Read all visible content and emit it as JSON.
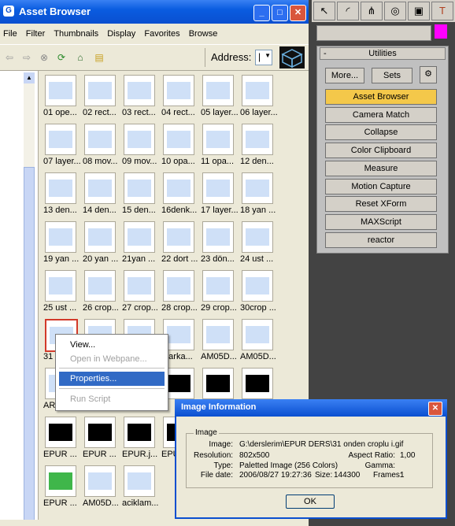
{
  "window": {
    "title": "Asset Browser",
    "minimize": "_",
    "maximize": "□",
    "close": "✕"
  },
  "menu": [
    "File",
    "Filter",
    "Thumbnails",
    "Display",
    "Favorites",
    "Browse"
  ],
  "toolbar": {
    "address_label": "Address:",
    "address_value": "|"
  },
  "thumbnails": [
    [
      "01 ope...",
      "02 rect...",
      "03 rect...",
      "04 rect...",
      "05 layer...",
      "06 layer..."
    ],
    [
      "07 layer...",
      "08 mov...",
      "09 mov...",
      "10 opa...",
      "11 opa...",
      "12 den..."
    ],
    [
      "13 den...",
      "14 den...",
      "15 den...",
      "16denk...",
      "17 layer...",
      "18 yan ..."
    ],
    [
      "19 yan ...",
      "20 yan ...",
      "21yan ...",
      "22 dort ...",
      "23 dön...",
      "24 ust ..."
    ],
    [
      "25 ust ...",
      "26 crop...",
      "27 crop...",
      "28 crop...",
      "29 crop...",
      "30crop ..."
    ],
    [
      "31",
      "",
      "",
      "4 arka...",
      "AM05D...",
      "AM05D..."
    ],
    [
      "ARABA...",
      "ARABA...",
      "ARABA...",
      "",
      "",
      ""
    ],
    [
      "EPUR ...",
      "EPUR ...",
      "EPUR.j...",
      "EPUR ...",
      "",
      ""
    ],
    [
      "EPUR ...",
      "AM05D...",
      "aciklam...",
      "",
      "",
      ""
    ]
  ],
  "context_menu": [
    {
      "label": "View...",
      "state": "normal"
    },
    {
      "label": "Open in Webpane...",
      "state": "disabled"
    },
    {
      "label": "Properties...",
      "state": "highlighted"
    },
    {
      "label": "Run Script",
      "state": "disabled"
    }
  ],
  "utilities": {
    "header": "Utilities",
    "more": "More...",
    "sets": "Sets",
    "buttons": [
      "Asset Browser",
      "Camera Match",
      "Collapse",
      "Color Clipboard",
      "Measure",
      "Motion Capture",
      "Reset XForm",
      "MAXScript",
      "reactor"
    ],
    "active": "Asset Browser"
  },
  "colors": {
    "swatch": "#ff00ff",
    "active_button": "#f4c84a",
    "titlebar": "#0a4fd0"
  },
  "dialog": {
    "title": "Image Information",
    "group": "Image",
    "image_label": "Image:",
    "image_value": "G:\\derslerim\\EPUR DERS\\31 onden croplu i.gif",
    "resolution_label": "Resolution:",
    "resolution_value": "802x500",
    "aspect_label": "Aspect Ratio:",
    "aspect_value": "1,00",
    "type_label": "Type:",
    "type_value": "Paletted Image (256 Colors)",
    "gamma_label": "Gamma:",
    "gamma_value": "",
    "date_label": "File date:",
    "date_value": "2006/08/27 19:27:36",
    "size_label": "Size:",
    "size_value": "144300",
    "frames_label": "Frames:",
    "frames_value": "1",
    "ok": "OK"
  }
}
